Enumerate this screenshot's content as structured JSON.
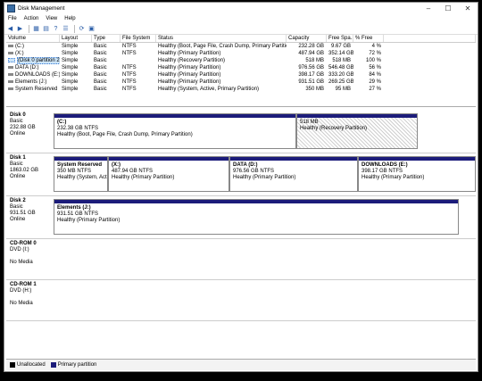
{
  "window": {
    "title": "Disk Management"
  },
  "menu": [
    "File",
    "Action",
    "View",
    "Help"
  ],
  "toolbar_icons": [
    "back-icon",
    "forward-icon",
    "console-icon",
    "properties-icon",
    "help-icon",
    "list-icon",
    "refresh-icon",
    "settings-icon"
  ],
  "columns": [
    "Volume",
    "Layout",
    "Type",
    "File System",
    "Status",
    "Capacity",
    "Free Spa...",
    "% Free"
  ],
  "volumes": [
    {
      "name": "(C:)",
      "layout": "Simple",
      "type": "Basic",
      "fs": "NTFS",
      "status": "Healthy (Boot, Page File, Crash Dump, Primary Partition)",
      "capacity": "232.28 GB",
      "free": "9.67 GB",
      "pct": "4 %"
    },
    {
      "name": "(X:)",
      "layout": "Simple",
      "type": "Basic",
      "fs": "NTFS",
      "status": "Healthy (Primary Partition)",
      "capacity": "487.94 GB",
      "free": "352.14 GB",
      "pct": "72 %"
    },
    {
      "name": "(Disk 0 partition 2)",
      "layout": "Simple",
      "type": "Basic",
      "fs": "",
      "status": "Healthy (Recovery Partition)",
      "capacity": "518 MB",
      "free": "518 MB",
      "pct": "100 %"
    },
    {
      "name": "DATA (D:)",
      "layout": "Simple",
      "type": "Basic",
      "fs": "NTFS",
      "status": "Healthy (Primary Partition)",
      "capacity": "976.56 GB",
      "free": "546.48 GB",
      "pct": "56 %"
    },
    {
      "name": "DOWNLOADS (E:)",
      "layout": "Simple",
      "type": "Basic",
      "fs": "NTFS",
      "status": "Healthy (Primary Partition)",
      "capacity": "398.17 GB",
      "free": "333.20 GB",
      "pct": "84 %"
    },
    {
      "name": "Elements (J:)",
      "layout": "Simple",
      "type": "Basic",
      "fs": "NTFS",
      "status": "Healthy (Primary Partition)",
      "capacity": "931.51 GB",
      "free": "269.25 GB",
      "pct": "29 %"
    },
    {
      "name": "System Reserved",
      "layout": "Simple",
      "type": "Basic",
      "fs": "NTFS",
      "status": "Healthy (System, Active, Primary Partition)",
      "capacity": "350 MB",
      "free": "95 MB",
      "pct": "27 %"
    }
  ],
  "disks": [
    {
      "name": "Disk 0",
      "type": "Basic",
      "size": "232.88 GB",
      "state": "Online",
      "parts": [
        {
          "title": "(C:)",
          "info": "232.38 GB NTFS",
          "status": "Healthy (Boot, Page File, Crash Dump, Primary Partition)"
        },
        {
          "title": "",
          "info": "518 MB",
          "status": "Healthy (Recovery Partition)"
        }
      ]
    },
    {
      "name": "Disk 1",
      "type": "Basic",
      "size": "1863.02 GB",
      "state": "Online",
      "parts": [
        {
          "title": "System Reserved",
          "info": "350 MB NTFS",
          "status": "Healthy (System, Activ"
        },
        {
          "title": "(X:)",
          "info": "487.94 GB NTFS",
          "status": "Healthy (Primary Partition)"
        },
        {
          "title": "DATA (D:)",
          "info": "976.56 GB NTFS",
          "status": "Healthy (Primary Partition)"
        },
        {
          "title": "DOWNLOADS (E:)",
          "info": "398.17 GB NTFS",
          "status": "Healthy (Primary Partition)"
        }
      ]
    },
    {
      "name": "Disk 2",
      "type": "Basic",
      "size": "931.51 GB",
      "state": "Online",
      "parts": [
        {
          "title": "Elements (J:)",
          "info": "931.51 GB NTFS",
          "status": "Healthy (Primary Partition)"
        }
      ]
    },
    {
      "name": "CD-ROM 0",
      "type": "DVD (I:)",
      "size": "",
      "state": "No Media",
      "parts": []
    },
    {
      "name": "CD-ROM 1",
      "type": "DVD (H:)",
      "size": "",
      "state": "No Media",
      "parts": []
    }
  ],
  "legend": [
    {
      "label": "Unallocated",
      "color": "#000000"
    },
    {
      "label": "Primary partition",
      "color": "#1c1c7a"
    }
  ]
}
